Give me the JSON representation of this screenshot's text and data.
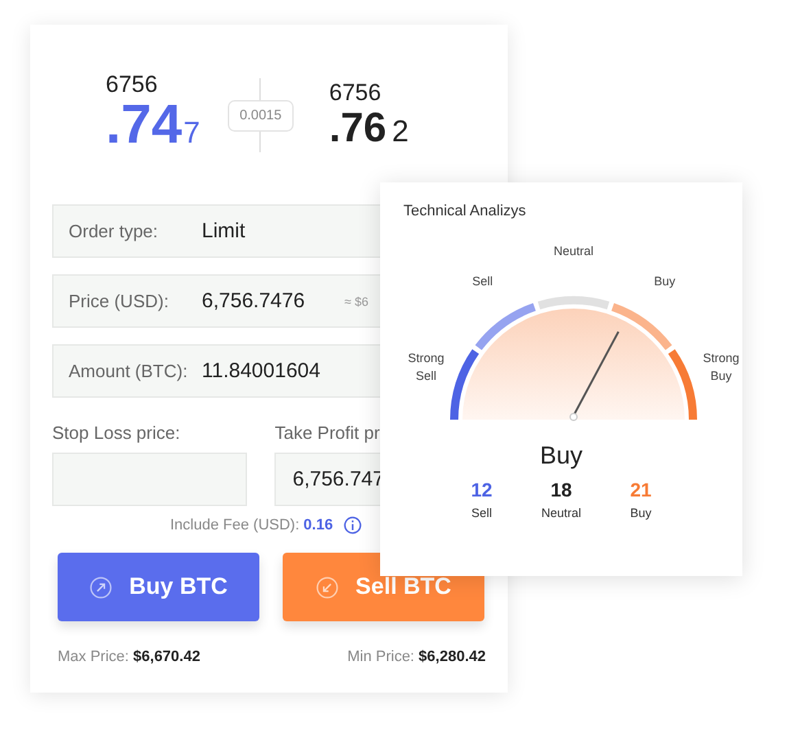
{
  "quote": {
    "bid": {
      "head": "6756",
      "main": ".74",
      "tail": "7"
    },
    "spread": "0.0015",
    "ask": {
      "head": "6756",
      "main": ".76",
      "tail": "2"
    }
  },
  "order_fields": [
    {
      "label": "Order type:",
      "value": "Limit"
    },
    {
      "label": "Price (USD):",
      "value": "6,756.7476",
      "note": "≈ $6"
    },
    {
      "label": "Amount (BTC):",
      "value": "11.84001604"
    }
  ],
  "limits": [
    {
      "label": "Stop Loss price:"
    },
    {
      "label": "Take Profit pr",
      "value": "6,756.747"
    }
  ],
  "fee": {
    "label": "Include Fee (USD):",
    "value": "0.16"
  },
  "buttons": [
    {
      "kind": "buy",
      "label": "Buy BTC"
    },
    {
      "kind": "sell",
      "label": "Sell BTC"
    }
  ],
  "footer": [
    {
      "label": "Max Price:",
      "value": "$6,670.42"
    },
    {
      "label": "Min Price:",
      "value": "$6,280.42"
    }
  ],
  "analysis": {
    "title": "Technical Analizys",
    "gauge": {
      "zones": [
        {
          "label": "Strong Sell",
          "color": "#4d63e4"
        },
        {
          "label": "Sell",
          "color": "#96a3f0"
        },
        {
          "label": "Neutral",
          "color": "#e1e1e1"
        },
        {
          "label": "Buy",
          "color": "#fbb48c"
        },
        {
          "label": "Strong Buy",
          "color": "#f77b35"
        }
      ]
    },
    "verdict": "Buy",
    "counts": [
      {
        "value": "12",
        "label": "Sell",
        "color": "#4d63e4"
      },
      {
        "value": "18",
        "label": "Neutral",
        "color": "#222222"
      },
      {
        "value": "21",
        "label": "Buy",
        "color": "#f77b35"
      }
    ]
  }
}
